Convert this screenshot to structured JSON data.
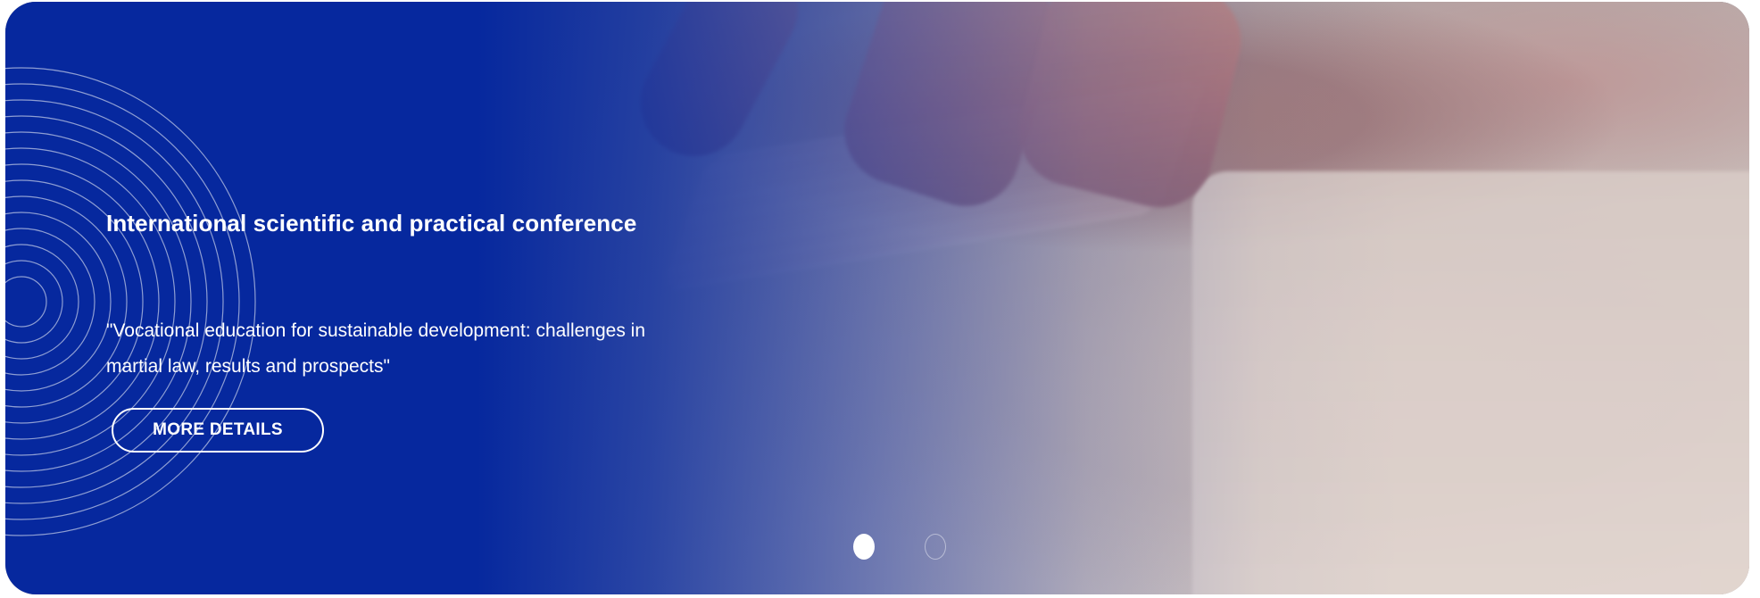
{
  "slider": {
    "title": "International scientific and practical conference",
    "subtitle": "\"Vocational education for sustainable development: challenges in martial law, results and prospects\"",
    "button_label": "MORE DETAILS",
    "slides_total": 2,
    "active_slide": 1
  },
  "colors": {
    "overlay_blue": "#06289e",
    "text": "#ffffff"
  },
  "icons": {
    "decoration": "concentric-rings"
  }
}
